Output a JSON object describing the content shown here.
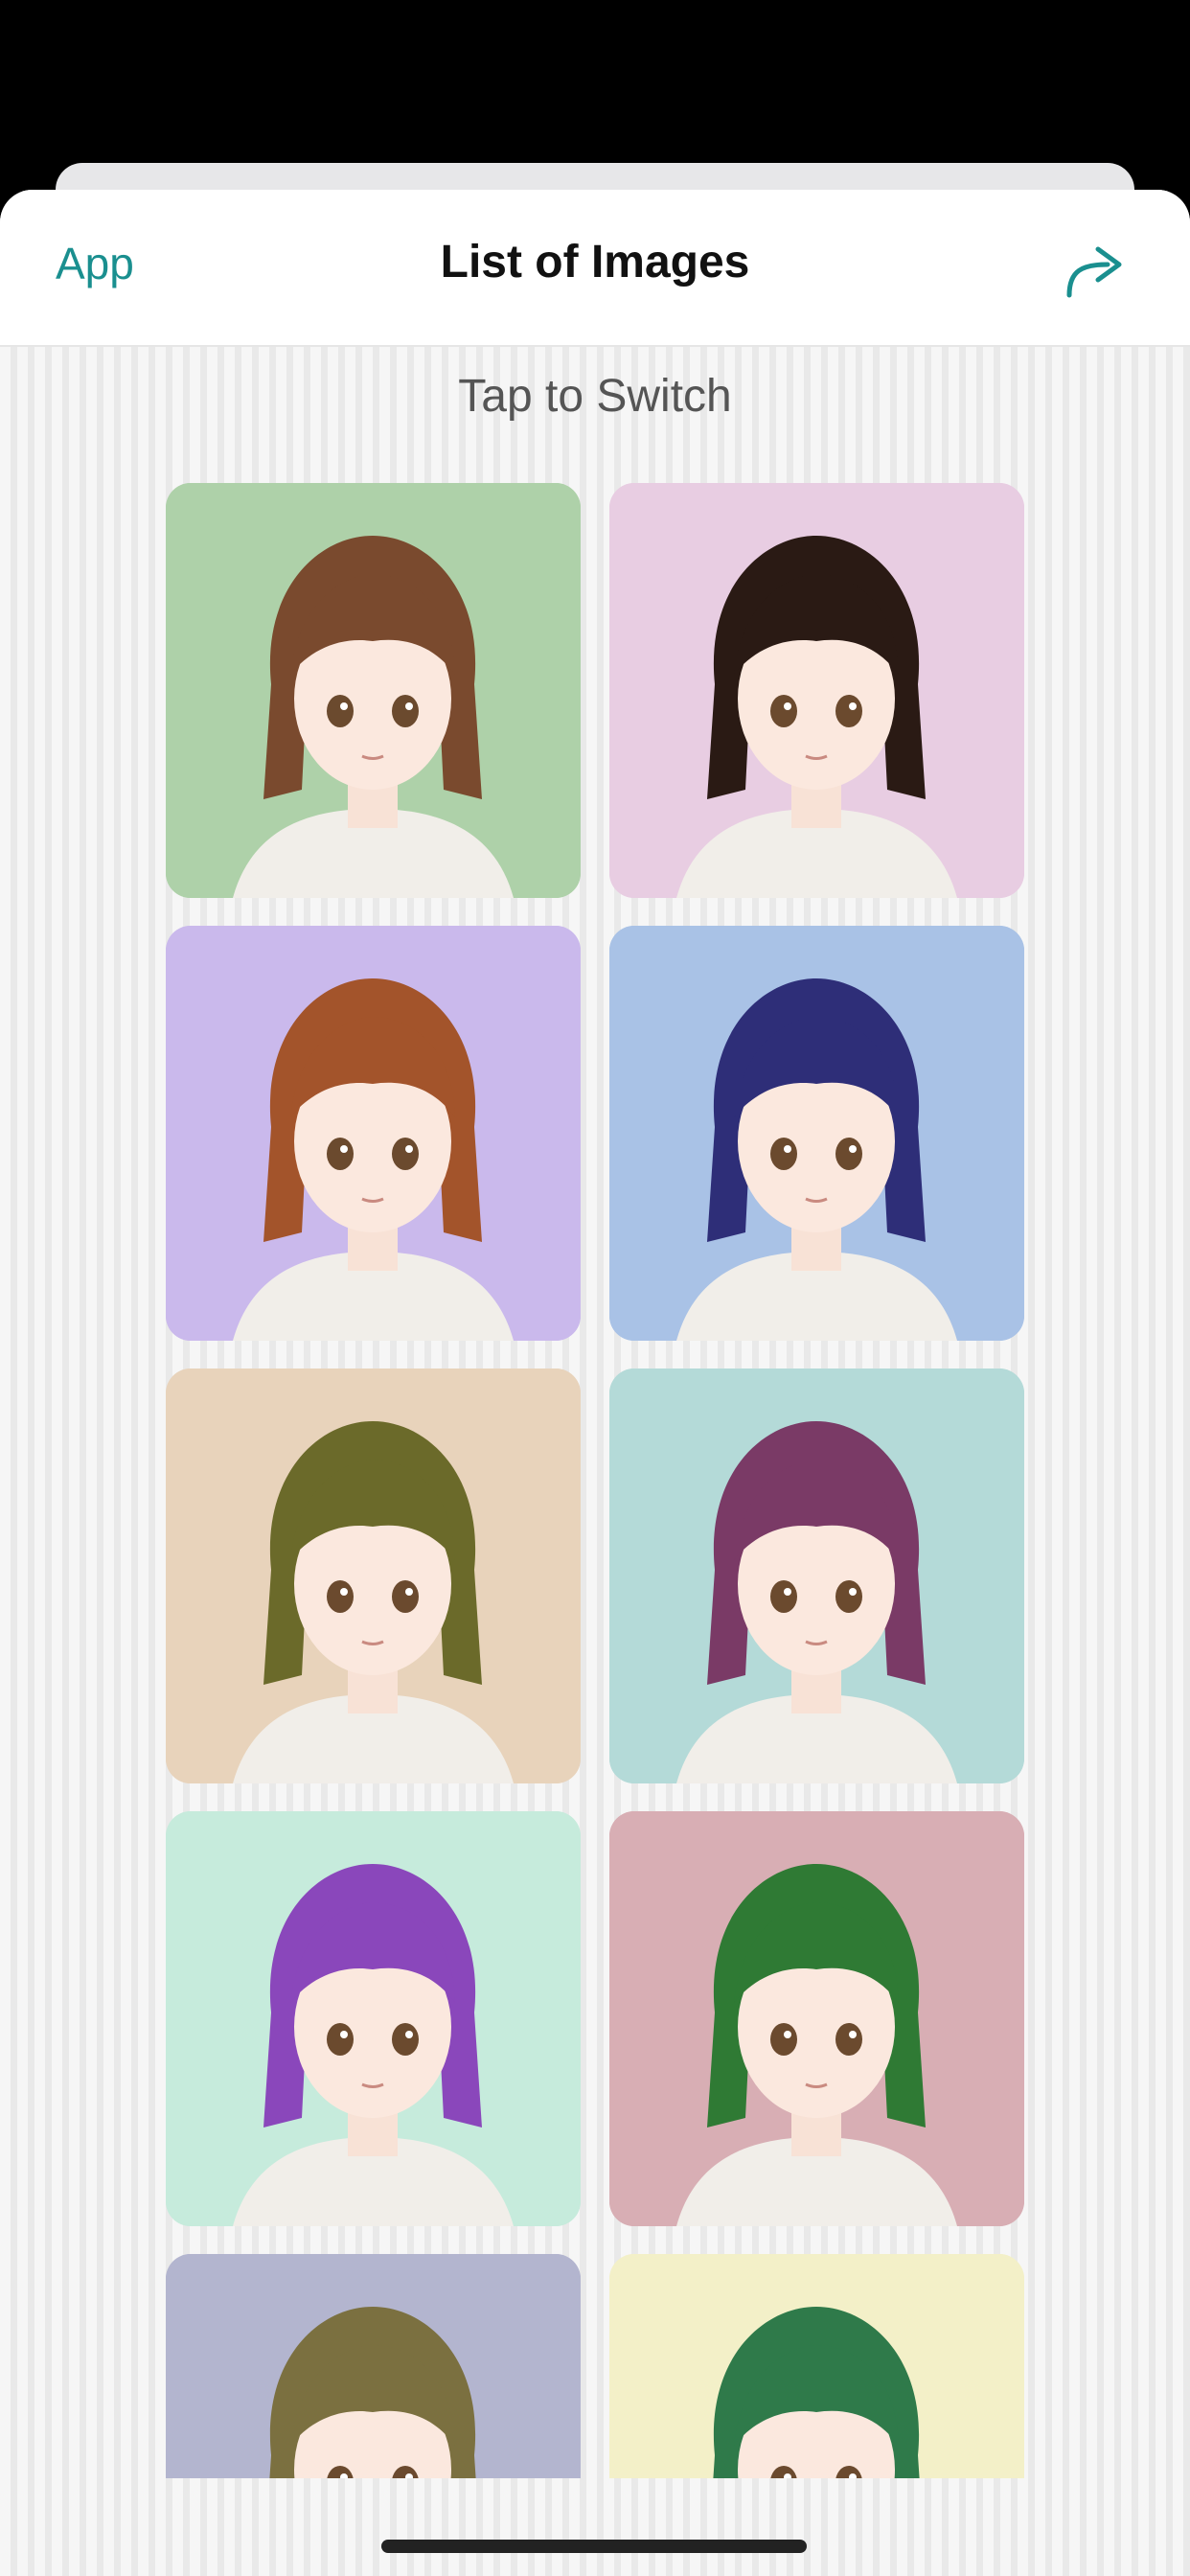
{
  "nav": {
    "back_label": "App",
    "title": "List of Images",
    "share_icon": "share-forward-icon"
  },
  "hint": "Tap to Switch",
  "colors": {
    "accent": "#1a8f8f",
    "title": "#111111"
  },
  "characters": [
    {
      "bg": "#aed1a9",
      "hair": "#7a4a2e"
    },
    {
      "bg": "#e8cde2",
      "hair": "#2a1a14"
    },
    {
      "bg": "#cab9ec",
      "hair": "#a3542b"
    },
    {
      "bg": "#a9c2e6",
      "hair": "#2e2e78"
    },
    {
      "bg": "#e8d3bb",
      "hair": "#6b6a2a"
    },
    {
      "bg": "#b4dad8",
      "hair": "#7a3a66"
    },
    {
      "bg": "#c6ebdc",
      "hair": "#8a47bb"
    },
    {
      "bg": "#d8aeb4",
      "hair": "#2f7a34"
    },
    {
      "bg": "#b3b5cf",
      "hair": "#7b7040"
    },
    {
      "bg": "#f3f0c8",
      "hair": "#2f7a4a"
    }
  ]
}
